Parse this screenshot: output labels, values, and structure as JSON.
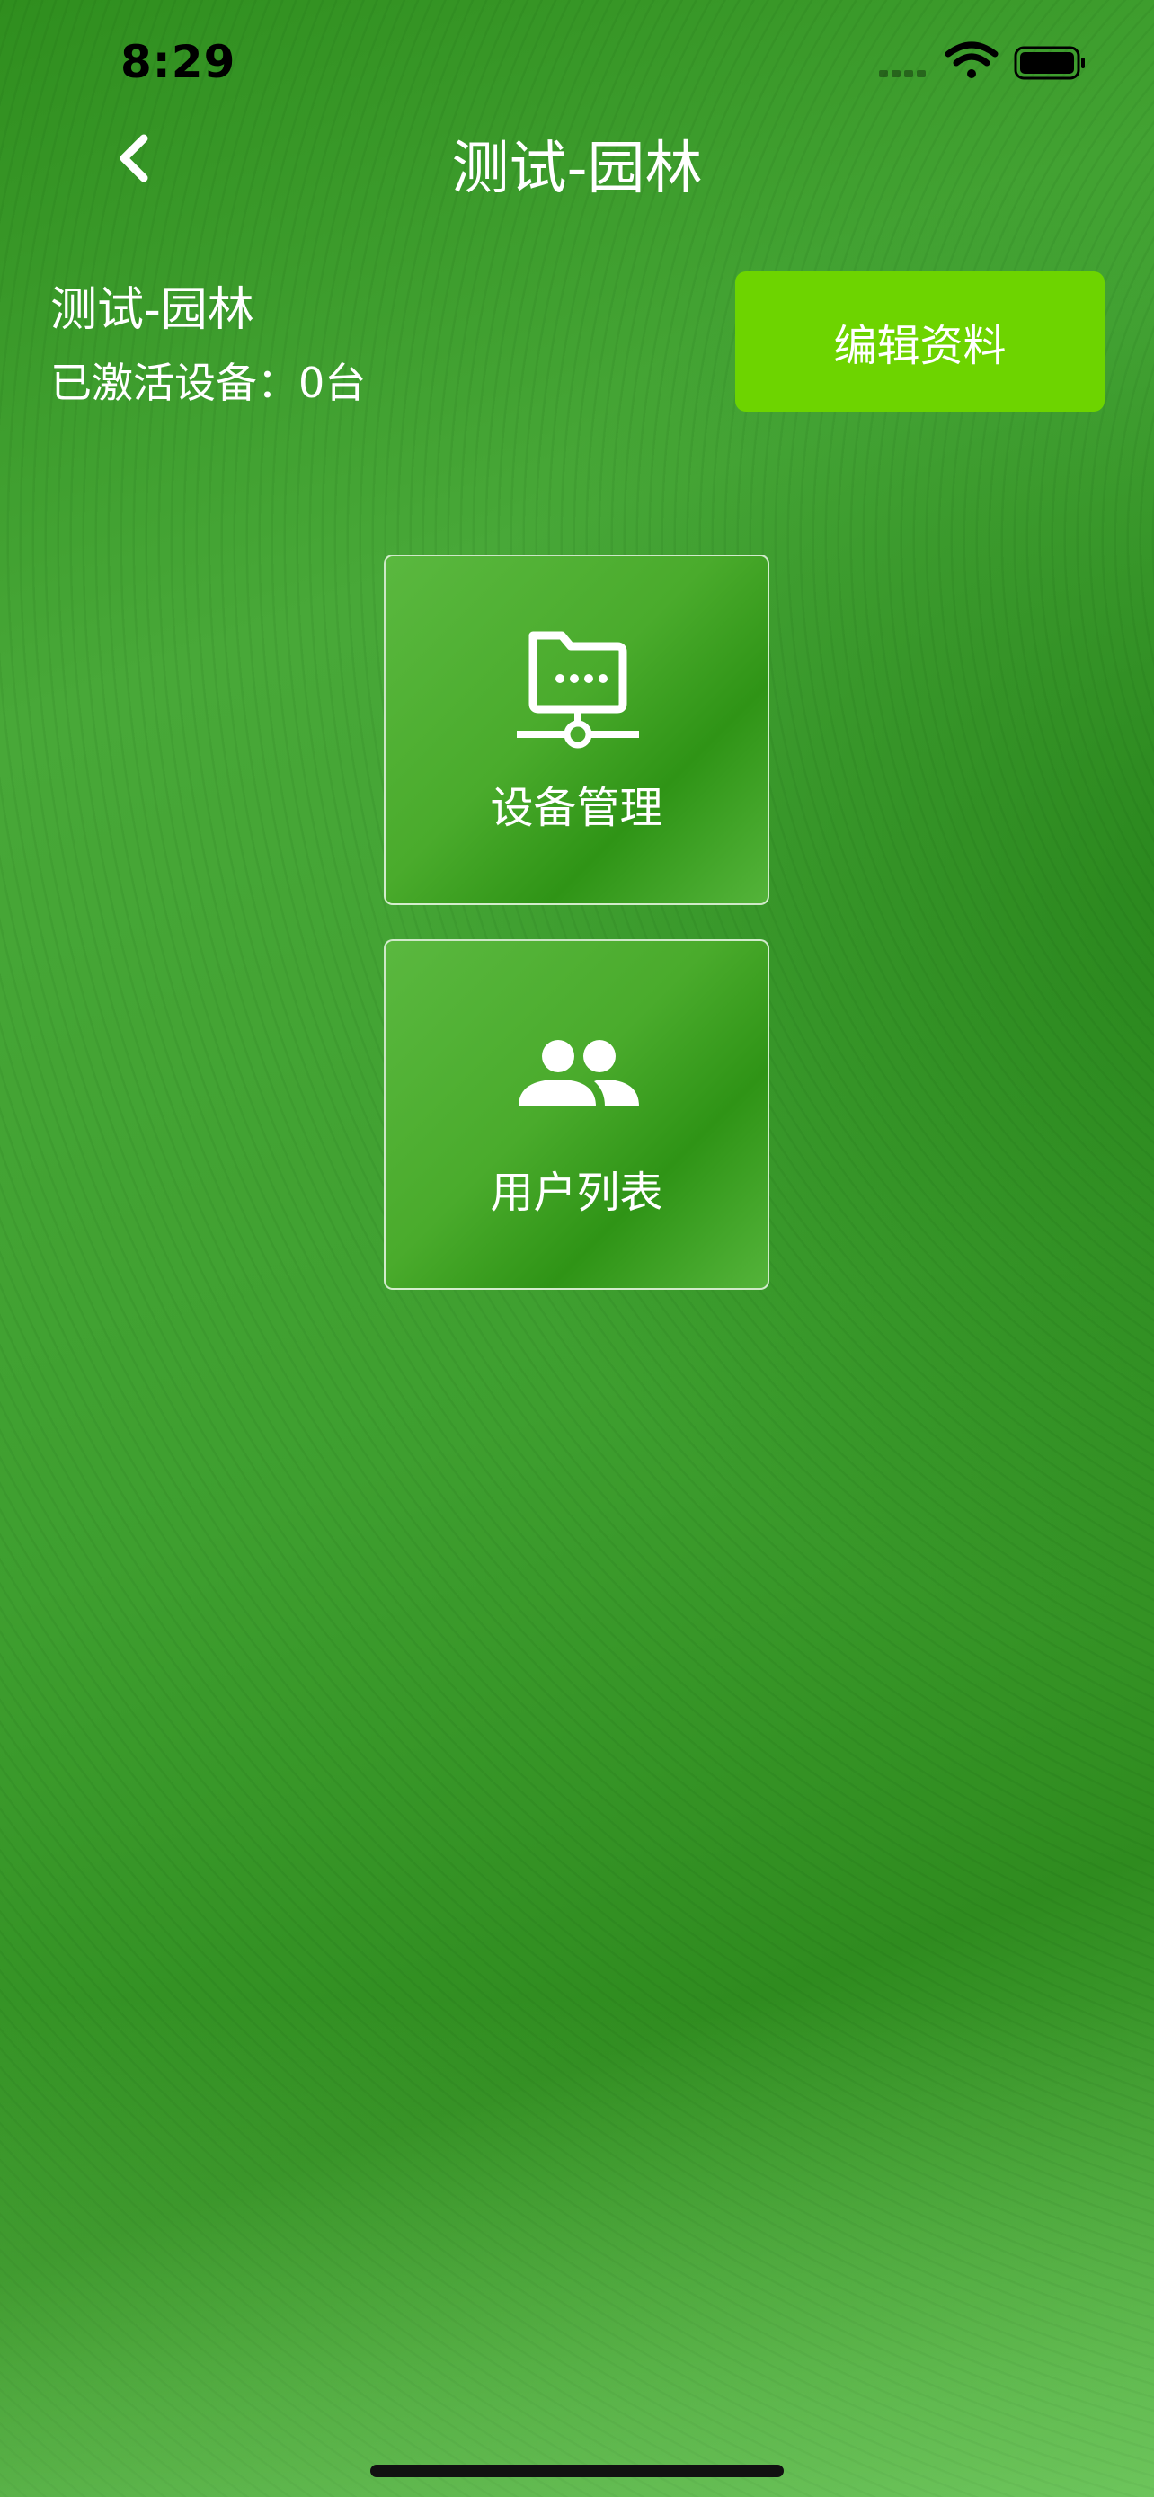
{
  "status_bar": {
    "time": "8:29",
    "icons": [
      "cellular-signal-icon",
      "wifi-icon",
      "battery-icon"
    ]
  },
  "nav": {
    "title": "测试-园林",
    "back_icon": "chevron-left-icon"
  },
  "org": {
    "name": "测试-园林",
    "device_count_label": "已激活设备：",
    "device_count_value": "0台"
  },
  "edit_button": {
    "label": "编辑资料"
  },
  "tiles": [
    {
      "label": "设备管理",
      "icon": "network-folder-icon"
    },
    {
      "label": "用户列表",
      "icon": "users-icon"
    }
  ],
  "colors": {
    "accent_button": "#6dd400",
    "background_green": "#3c9a2a",
    "text": "#ffffff"
  }
}
